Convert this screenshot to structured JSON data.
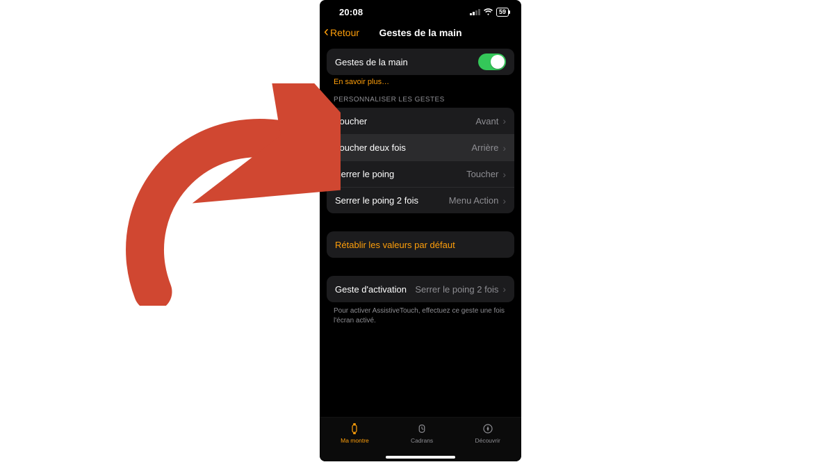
{
  "accent": "#ff9f0a",
  "status": {
    "time": "20:08",
    "battery": "59"
  },
  "nav": {
    "back": "Retour",
    "title": "Gestes de la main"
  },
  "toggle_row": {
    "label": "Gestes de la main",
    "on": true
  },
  "learn_more": "En savoir plus…",
  "section_header": "PERSONNALISER LES GESTES",
  "gestures": [
    {
      "label": "Toucher",
      "value": "Avant"
    },
    {
      "label": "Toucher deux fois",
      "value": "Arrière"
    },
    {
      "label": "Serrer le poing",
      "value": "Toucher"
    },
    {
      "label": "Serrer le poing 2 fois",
      "value": "Menu Action"
    }
  ],
  "reset": "Rétablir les valeurs par défaut",
  "activation": {
    "label": "Geste d'activation",
    "value": "Serrer le poing 2 fois",
    "note": "Pour activer AssistiveTouch, effectuez ce geste une fois l'écran activé."
  },
  "tabs": {
    "watch": "Ma montre",
    "faces": "Cadrans",
    "discover": "Découvrir"
  },
  "annotation_arrow_color": "#d04731"
}
